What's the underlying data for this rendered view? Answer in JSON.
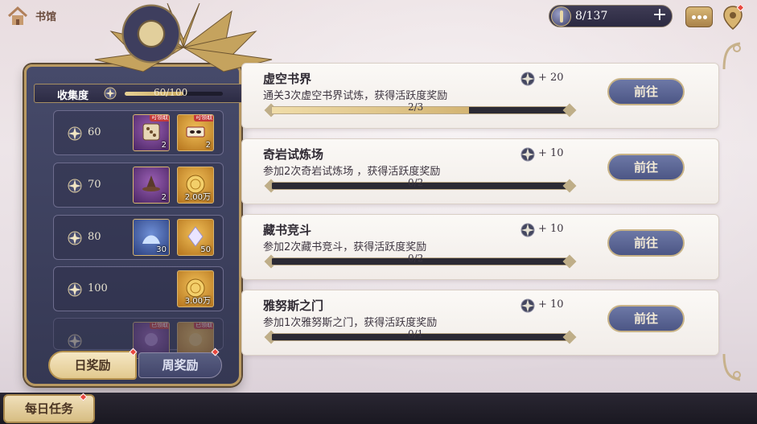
{
  "header": {
    "title": "书馆",
    "energy": "8/137"
  },
  "collection": {
    "label": "收集度",
    "value": "60/100",
    "progress": 0.6
  },
  "tiers": [
    {
      "value": "60",
      "items": [
        {
          "type": "dice",
          "count": "2",
          "tag": "可领取"
        },
        {
          "type": "mask",
          "count": "2",
          "tag": "可领取"
        }
      ]
    },
    {
      "value": "70",
      "items": [
        {
          "type": "witch-hat",
          "count": "2"
        },
        {
          "type": "gold-coin",
          "count": "2.00万"
        }
      ]
    },
    {
      "value": "80",
      "items": [
        {
          "type": "powder",
          "count": "30"
        },
        {
          "type": "crystal",
          "count": "50"
        }
      ]
    },
    {
      "value": "100",
      "items": [
        {
          "type": "gold-coin",
          "count": "3.00万"
        }
      ]
    },
    {
      "value": "",
      "items": [
        {
          "type": "purple-item",
          "tag": "已领取"
        },
        {
          "type": "gold-item",
          "tag": "已领取"
        }
      ]
    }
  ],
  "tabs": {
    "daily": "日奖励",
    "weekly": "周奖励"
  },
  "tasks": [
    {
      "name": "虚空书界",
      "desc": "通关3次虚空书界试炼，获得活跃度奖励",
      "reward": "+ 20",
      "progress_text": "2/3",
      "progress": 0.667,
      "button": "前往"
    },
    {
      "name": "奇岩试炼场",
      "desc": "参加2次奇岩试炼场 ，获得活跃度奖励",
      "reward": "+ 10",
      "progress_text": "0/2",
      "progress": 0,
      "button": "前往"
    },
    {
      "name": "藏书竞斗",
      "desc": "参加2次藏书竞斗，获得活跃度奖励",
      "reward": "+ 10",
      "progress_text": "0/2",
      "progress": 0,
      "button": "前往"
    },
    {
      "name": "雅努斯之门",
      "desc": "参加1次雅努斯之门，获得活跃度奖励",
      "reward": "+ 10",
      "progress_text": "0/1",
      "progress": 0,
      "button": "前往"
    }
  ],
  "bottom": {
    "daily_tasks": "每日任务"
  },
  "colors": {
    "accent_gold": "#c8b387",
    "button_blue": "#4c5685",
    "notification_red": "#e8473e"
  }
}
